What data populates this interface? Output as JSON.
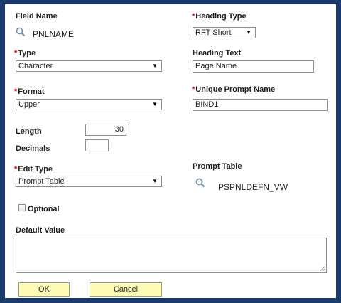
{
  "left": {
    "field_name": {
      "label": "Field Name",
      "value": "PNLNAME",
      "icon": "search-icon"
    },
    "type": {
      "label": "Type",
      "value": "Character"
    },
    "format": {
      "label": "Format",
      "value": "Upper"
    },
    "length": {
      "label": "Length",
      "value": "30"
    },
    "decimals": {
      "label": "Decimals",
      "value": ""
    },
    "edit_type": {
      "label": "Edit Type",
      "value": "Prompt Table"
    },
    "optional": {
      "label": "Optional",
      "checked": false
    },
    "default_value": {
      "label": "Default Value",
      "value": ""
    }
  },
  "right": {
    "heading_type": {
      "label": "Heading Type",
      "value": "RFT Short"
    },
    "heading_text": {
      "label": "Heading Text",
      "value": "Page Name"
    },
    "unique_prompt_name": {
      "label": "Unique Prompt Name",
      "value": "BIND1"
    },
    "prompt_table": {
      "label": "Prompt Table",
      "value": "PSPNLDEFN_VW",
      "icon": "search-icon"
    }
  },
  "required_marker": "*",
  "buttons": {
    "ok": "OK",
    "cancel": "Cancel"
  },
  "colors": {
    "frame": "#1a3a6b",
    "button_bg": "#fdfbb6",
    "required": "#cc0000"
  }
}
